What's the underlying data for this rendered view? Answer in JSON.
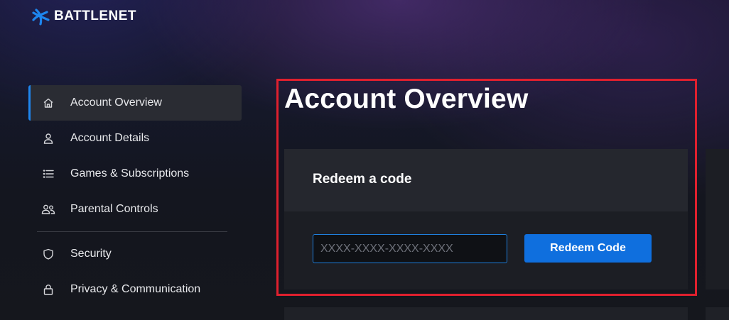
{
  "brand": {
    "name": "BATTLENET",
    "accent_color": "#1e86ee",
    "icon": "battlenet-logo-icon"
  },
  "sidebar": {
    "items": [
      {
        "label": "Account Overview",
        "icon": "home-icon",
        "active": true
      },
      {
        "label": "Account Details",
        "icon": "user-icon",
        "active": false
      },
      {
        "label": "Games & Subscriptions",
        "icon": "list-icon",
        "active": false
      },
      {
        "label": "Parental Controls",
        "icon": "users-icon",
        "active": false
      },
      {
        "label": "Security",
        "icon": "shield-icon",
        "active": false
      },
      {
        "label": "Privacy & Communication",
        "icon": "lock-icon",
        "active": false
      }
    ]
  },
  "main": {
    "title": "Account Overview",
    "highlight_color": "#e0202e",
    "redeem": {
      "title": "Redeem a code",
      "input_placeholder": "XXXX-XXXX-XXXX-XXXX",
      "input_value": "",
      "button_label": "Redeem Code",
      "button_color": "#0f6fde"
    }
  }
}
